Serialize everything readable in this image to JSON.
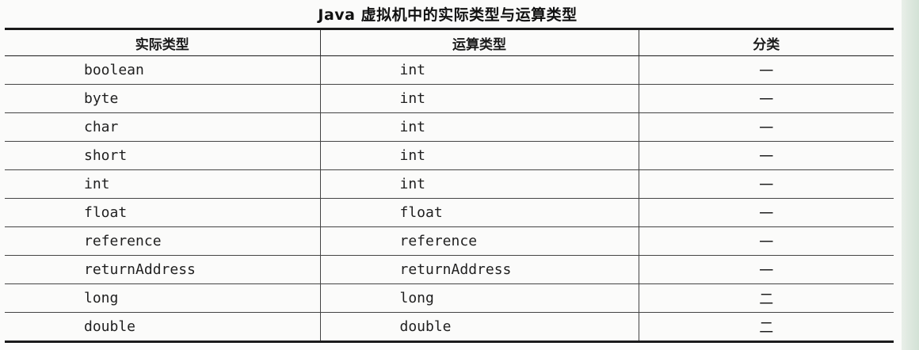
{
  "title": "Java 虚拟机中的实际类型与运算类型",
  "headers": [
    "实际类型",
    "运算类型",
    "分类"
  ],
  "rows": [
    {
      "actual": "boolean",
      "compute": "int",
      "category": "一"
    },
    {
      "actual": "byte",
      "compute": "int",
      "category": "一"
    },
    {
      "actual": "char",
      "compute": "int",
      "category": "一"
    },
    {
      "actual": "short",
      "compute": "int",
      "category": "一"
    },
    {
      "actual": "int",
      "compute": "int",
      "category": "一"
    },
    {
      "actual": "float",
      "compute": "float",
      "category": "一"
    },
    {
      "actual": "reference",
      "compute": "reference",
      "category": "一"
    },
    {
      "actual": "returnAddress",
      "compute": "returnAddress",
      "category": "一"
    },
    {
      "actual": "long",
      "compute": "long",
      "category": "二"
    },
    {
      "actual": "double",
      "compute": "double",
      "category": "二"
    }
  ]
}
